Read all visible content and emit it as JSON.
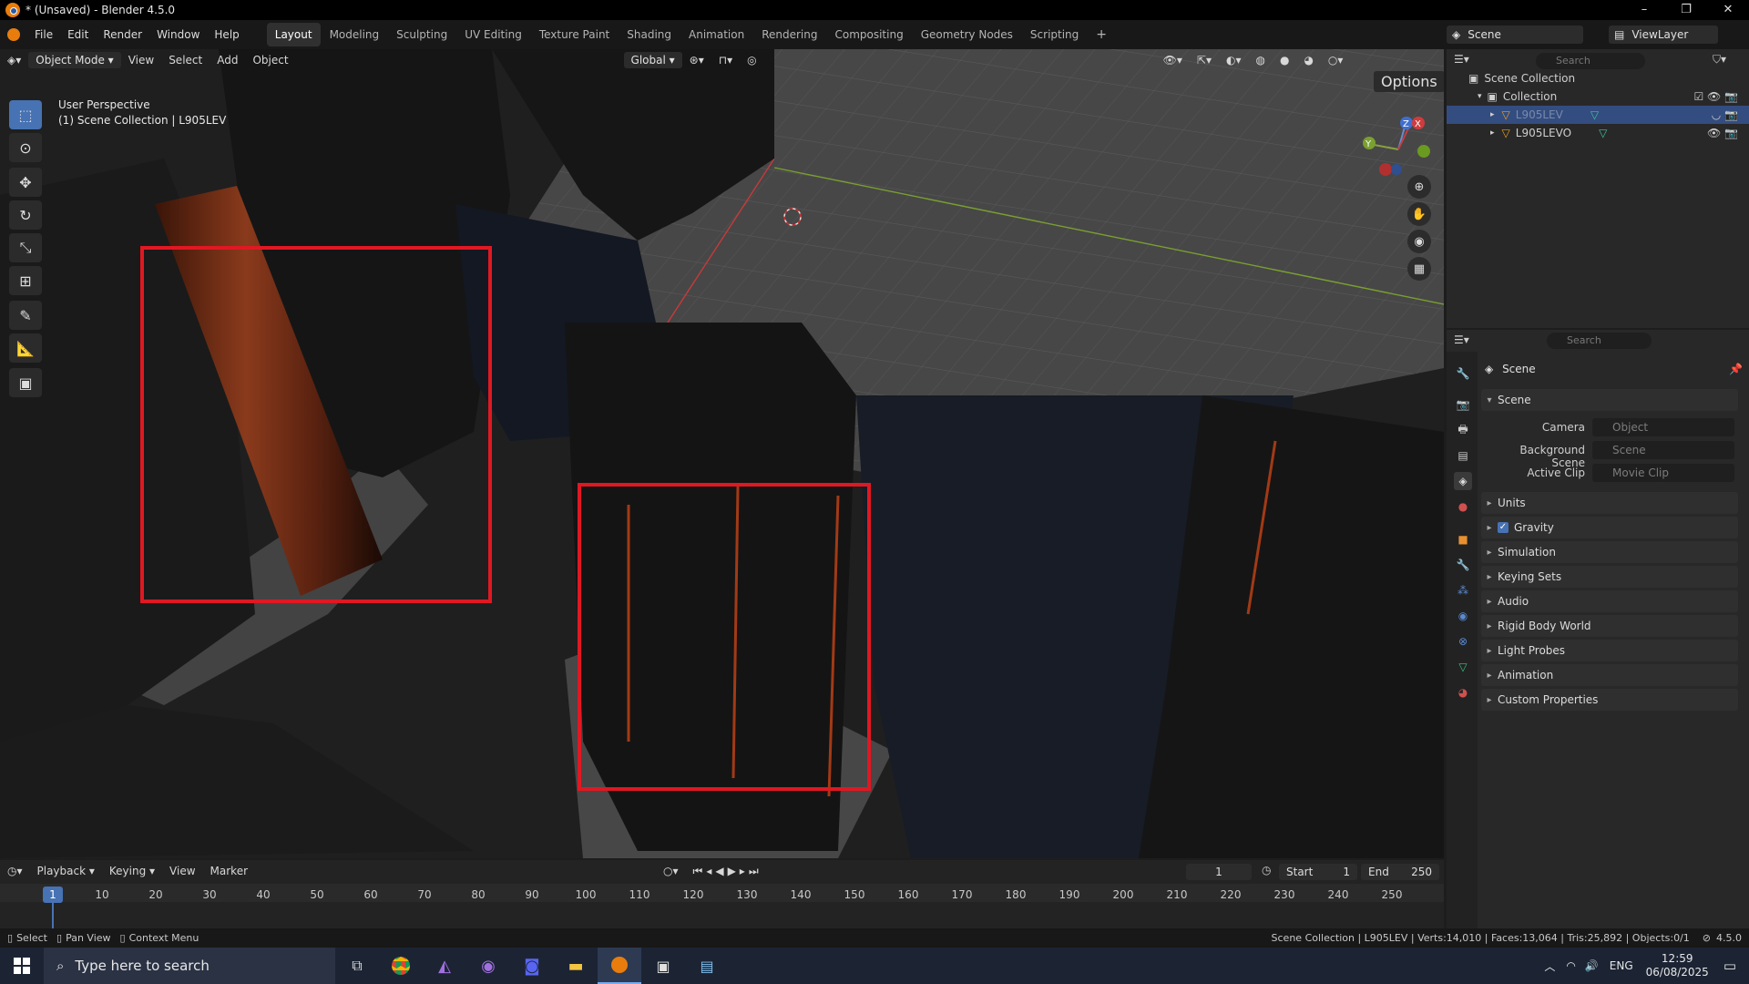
{
  "window": {
    "title": "* (Unsaved) - Blender 4.5.0",
    "buttons": [
      "–",
      "❐",
      "✕"
    ]
  },
  "menubar": {
    "menus": [
      "File",
      "Edit",
      "Render",
      "Window",
      "Help"
    ],
    "workspaces": [
      "Layout",
      "Modeling",
      "Sculpting",
      "UV Editing",
      "Texture Paint",
      "Shading",
      "Animation",
      "Rendering",
      "Compositing",
      "Geometry Nodes",
      "Scripting"
    ],
    "active_workspace": "Layout",
    "add_tab": "+",
    "scene_name": "Scene",
    "view_layer": "ViewLayer"
  },
  "viewport": {
    "mode": "Object Mode",
    "menus": [
      "View",
      "Select",
      "Add",
      "Object"
    ],
    "transform_orientation": "Global",
    "options_label": "Options",
    "overlay_line1": "User Perspective",
    "overlay_line2": "(1) Scene Collection | L905LEV",
    "gizmo_axes": {
      "x": "X",
      "y": "Y",
      "z": "Z"
    },
    "tools": [
      "select-box",
      "cursor",
      "move",
      "rotate",
      "scale",
      "transform",
      "annotate",
      "measure",
      "add-cube"
    ]
  },
  "outliner": {
    "search_placeholder": "Search",
    "root": "Scene Collection",
    "collection": "Collection",
    "objects": [
      {
        "name": "L905LEV",
        "selected": true
      },
      {
        "name": "L905LEVO",
        "selected": false
      }
    ]
  },
  "properties": {
    "search_placeholder": "Search",
    "context_title": "Scene",
    "section_title": "Scene",
    "fields": [
      {
        "label": "Camera",
        "placeholder": "Object"
      },
      {
        "label": "Background Scene",
        "placeholder": "Scene"
      },
      {
        "label": "Active Clip",
        "placeholder": "Movie Clip"
      }
    ],
    "panels": [
      "Units",
      "Gravity",
      "Simulation",
      "Keying Sets",
      "Audio",
      "Rigid Body World",
      "Light Probes",
      "Animation",
      "Custom Properties"
    ],
    "gravity_checked": true
  },
  "timeline": {
    "menus": [
      "Playback",
      "Keying",
      "View",
      "Marker"
    ],
    "current_frame": "1",
    "start_label": "Start",
    "start_value": "1",
    "end_label": "End",
    "end_value": "250",
    "ruler": [
      "1",
      "10",
      "20",
      "30",
      "40",
      "50",
      "60",
      "70",
      "80",
      "90",
      "100",
      "110",
      "120",
      "130",
      "140",
      "150",
      "160",
      "170",
      "180",
      "190",
      "200",
      "210",
      "220",
      "230",
      "240",
      "250"
    ]
  },
  "statusbar": {
    "hints": [
      "Select",
      "Pan View",
      "Context Menu"
    ],
    "stats": "Scene Collection | L905LEV | Verts:14,010 | Faces:13,064 | Tris:25,892 | Objects:0/1",
    "version": "4.5.0"
  },
  "taskbar": {
    "search_placeholder": "Type here to search",
    "language": "ENG",
    "time": "12:59",
    "date": "06/08/2025"
  },
  "colors": {
    "accent": "#4772b3",
    "selection_box": "#e01822",
    "blender_orange": "#e87d0d"
  }
}
